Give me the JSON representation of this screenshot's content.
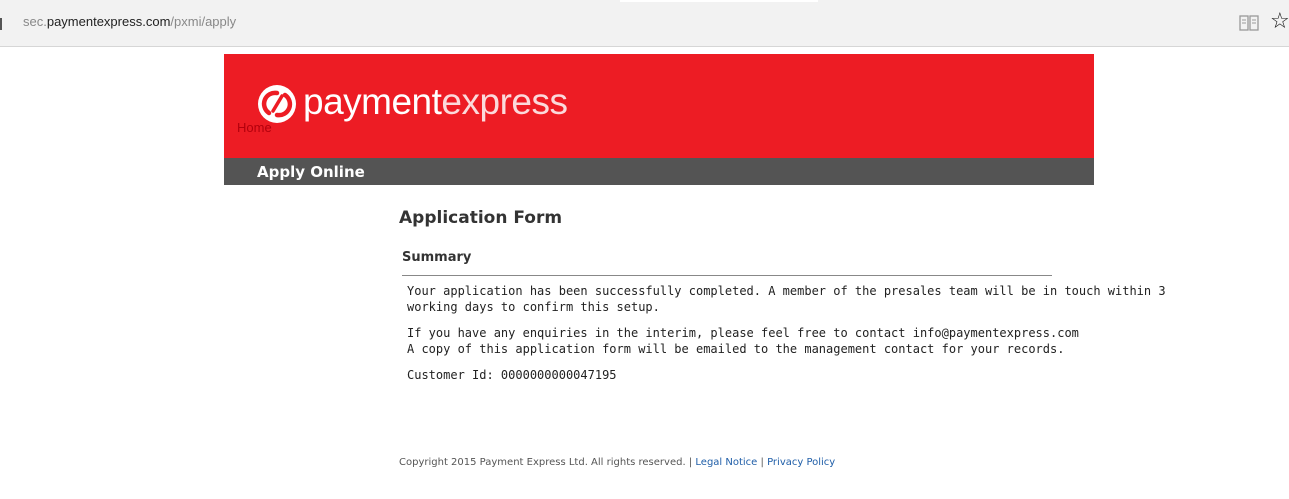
{
  "browser": {
    "url_prefix": "sec.",
    "url_host": "paymentexpress.com",
    "url_path": "/pxmi/apply"
  },
  "header": {
    "logo_text_primary": "payment",
    "logo_text_secondary": "express",
    "home_link": "Home",
    "nav_label": "Apply Online"
  },
  "main": {
    "title": "Application Form",
    "section_title": "Summary",
    "messages": [
      "Your application has been successfully completed. A member of the presales team will be in touch within 3",
      "working days to confirm this setup.",
      "If you have any enquiries in the interim, please feel free to contact info@paymentexpress.com",
      "A copy of this application form will be emailed to the management contact for your records.",
      "Customer Id: 0000000000047195"
    ]
  },
  "footer": {
    "copyright": "Copyright 2015 Payment Express Ltd. All rights reserved.",
    "separator": "|",
    "legal_link": "Legal Notice",
    "privacy_link": "Privacy Policy"
  },
  "colors": {
    "brand_red": "#ed1c24",
    "nav_gray": "#545454",
    "link_blue": "#1f5ea8"
  }
}
